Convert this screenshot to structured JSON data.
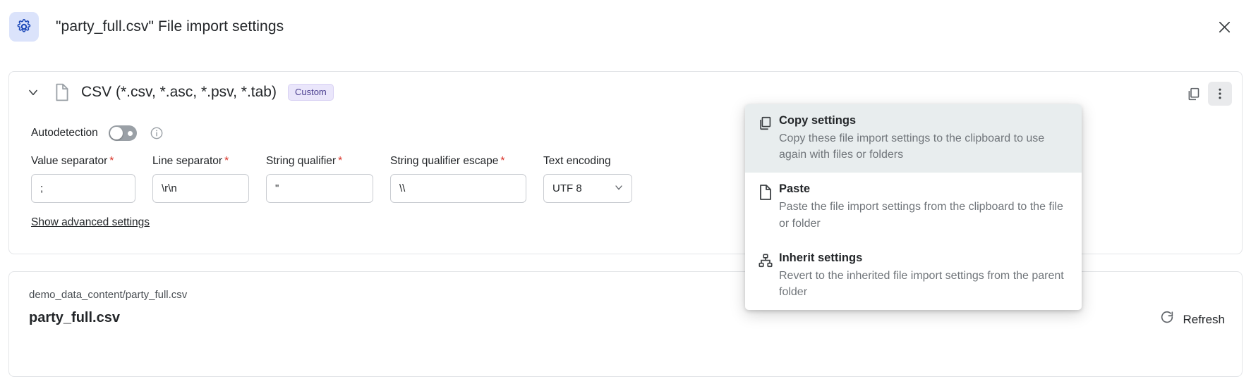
{
  "header": {
    "title": "\"party_full.csv\" File import settings",
    "gear_icon": "gear-icon",
    "close_icon": "close-icon",
    "accent_color": "#dbe3fb"
  },
  "settings_card": {
    "collapse_icon": "chevron-down-icon",
    "file_icon": "file-icon",
    "format_label": "CSV (*.csv, *.asc, *.psv, *.tab)",
    "badge": "Custom",
    "badge_color": "#eae6fb",
    "copy_icon": "copy-icon",
    "more_icon": "kebab-menu-icon",
    "autodetection": {
      "label": "Autodetection",
      "state": "off",
      "info_icon": "info-icon"
    },
    "fields": [
      {
        "label": "Value separator",
        "required": true,
        "value": ";"
      },
      {
        "label": "Line separator",
        "required": true,
        "value": "\\r\\n"
      },
      {
        "label": "String qualifier",
        "required": true,
        "value": "\""
      },
      {
        "label": "String qualifier escape",
        "required": true,
        "value": "\\\\"
      }
    ],
    "encoding": {
      "label": "Text encoding",
      "required": false,
      "value": "UTF 8",
      "chevron_icon": "chevron-down-icon"
    },
    "advanced_link": "Show advanced settings"
  },
  "context_menu": {
    "items": [
      {
        "title": "Copy settings",
        "description": "Copy these file import settings to the clipboard to use again with files or folders",
        "icon": "copy-icon",
        "hovered": true
      },
      {
        "title": "Paste",
        "description": "Paste the file import settings from the clipboard to the file or folder",
        "icon": "paste-file-icon",
        "hovered": false
      },
      {
        "title": "Inherit settings",
        "description": "Revert to the inherited file import settings from the parent folder",
        "icon": "hierarchy-icon",
        "hovered": false
      }
    ]
  },
  "file_card": {
    "path": "demo_data_content/party_full.csv",
    "name": "party_full.csv",
    "refresh_label": "Refresh",
    "refresh_icon": "refresh-icon"
  }
}
